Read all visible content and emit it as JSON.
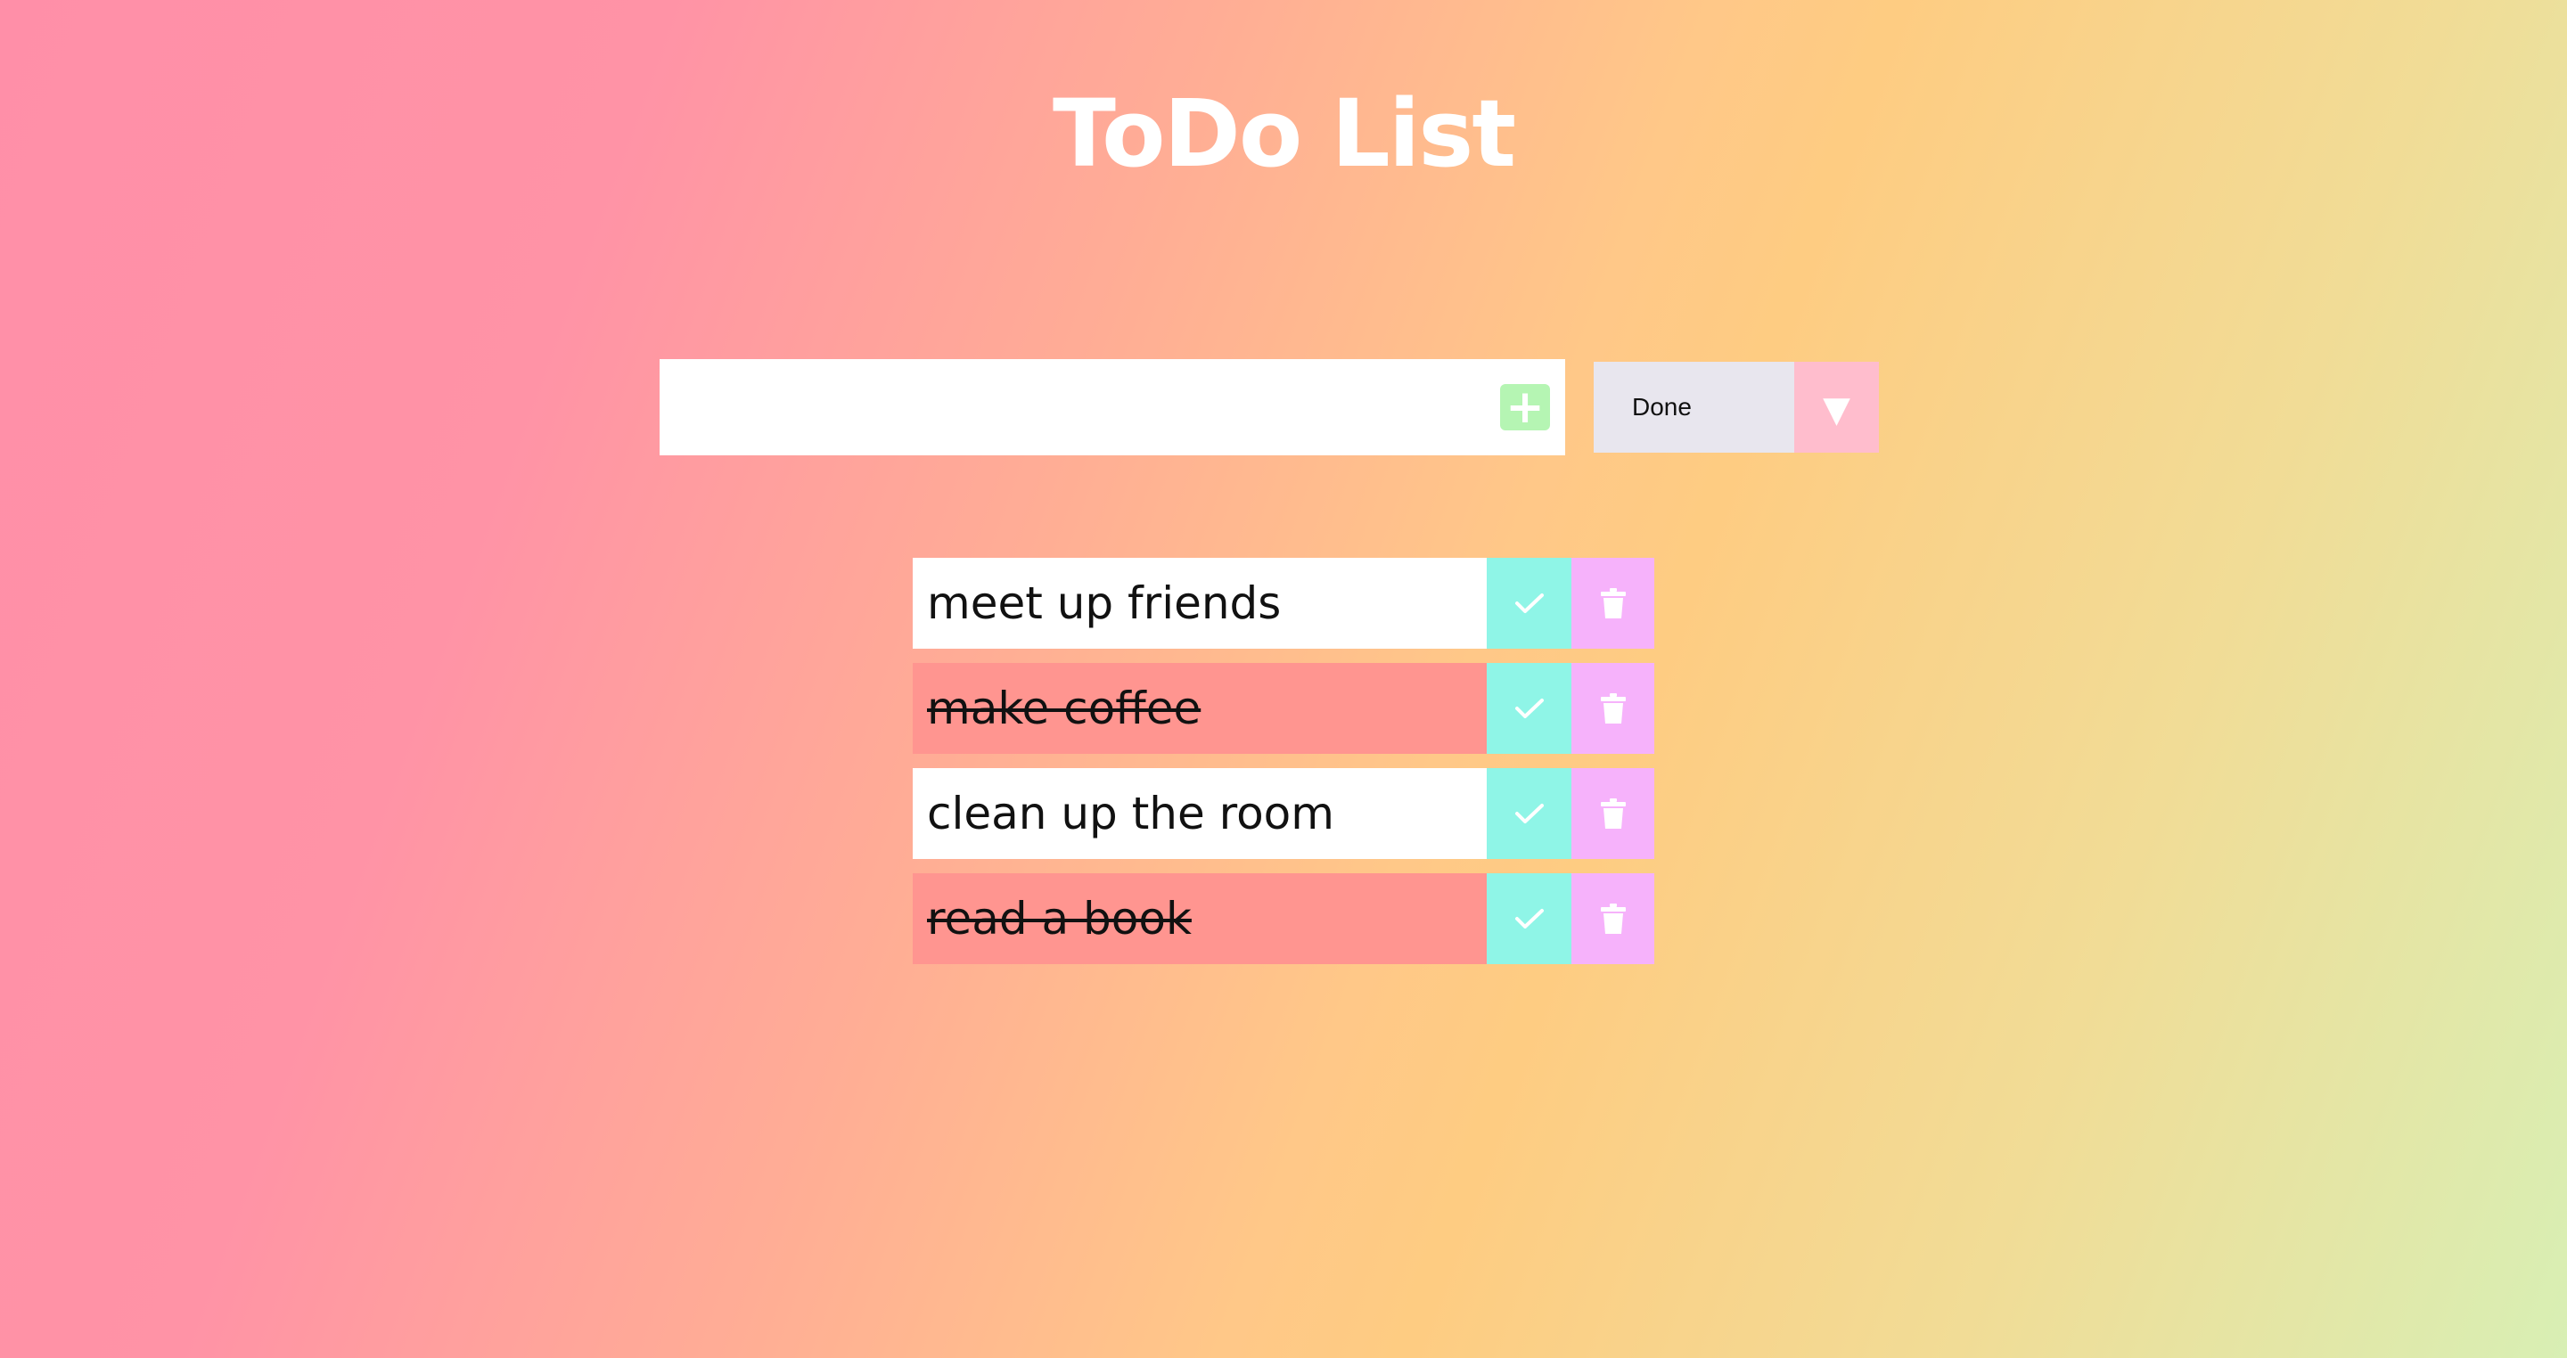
{
  "header": {
    "title": "ToDo List"
  },
  "form": {
    "input_value": "",
    "add_icon": "plus-icon",
    "add_symbol": "+"
  },
  "filter": {
    "selected": "Done",
    "arrow_icon": "dropdown-triangle-icon",
    "arrow_symbol": "▼"
  },
  "todos": [
    {
      "text": "meet up friends",
      "completed": false
    },
    {
      "text": "make coffee",
      "completed": true
    },
    {
      "text": "clean up the room",
      "completed": false
    },
    {
      "text": "read a book",
      "completed": true
    }
  ],
  "colors": {
    "input_bg": "#ffffff",
    "add_button": "#b5f5b3",
    "filter_bg": "#e8e6ee",
    "filter_arrow_bg": "#ffbdcd",
    "item_bg": "#ffffff",
    "item_completed_bg": "#ff9590",
    "check_button": "#8ff5e7",
    "trash_button": "#f6b2fb"
  }
}
